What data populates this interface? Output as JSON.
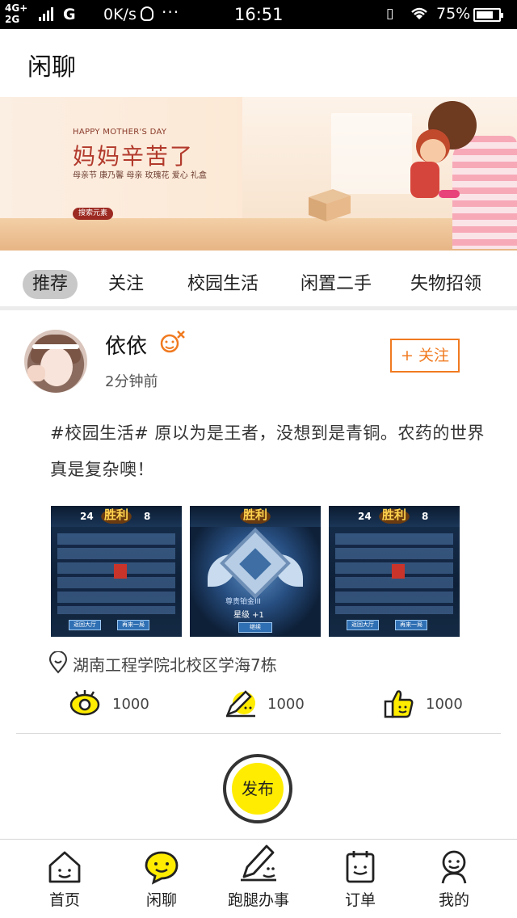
{
  "status_bar": {
    "network_top": "4G+",
    "network_bottom": "2G",
    "carrier": "G",
    "speed": "0K/s",
    "overflow": "···",
    "time": "16:51",
    "battery_percent": "75%",
    "battery_level": 0.75
  },
  "header": {
    "title": "闲聊"
  },
  "banner": {
    "subtitle_en": "HAPPY MOTHER'S DAY",
    "headline": "妈妈辛苦了",
    "tags": "母亲节 康乃馨 母亲 玫瑰花 爱心 礼盒",
    "button": "搜索元素"
  },
  "tabs": [
    {
      "label": "推荐",
      "active": true
    },
    {
      "label": "关注",
      "active": false
    },
    {
      "label": "校园生活",
      "active": false
    },
    {
      "label": "闲置二手",
      "active": false
    },
    {
      "label": "失物招领",
      "active": false
    }
  ],
  "post": {
    "username": "依依",
    "time_ago": "2分钟前",
    "follow_label": "+ 关注",
    "text": "#校园生活#  原以为是王者，没想到是青铜。农药的世界真是复杂噢！",
    "images": [
      {
        "type": "scoreboard",
        "title": "胜利",
        "left_score": "24",
        "right_score": "8",
        "btn1": "返回大厅",
        "btn2": "再来一局"
      },
      {
        "type": "rank",
        "title": "胜利",
        "rank_name": "尊贵铂金III",
        "star": "星级 +1",
        "btn": "继续"
      },
      {
        "type": "scoreboard",
        "title": "胜利",
        "left_score": "24",
        "right_score": "8",
        "btn1": "返回大厅",
        "btn2": "再来一局"
      }
    ],
    "location": "湖南工程学院北校区学海7栋",
    "stats": {
      "views": "1000",
      "comments": "1000",
      "likes": "1000"
    },
    "colors": {
      "accent": "#f07a20",
      "highlight": "#ffec00"
    }
  },
  "publish": {
    "label": "发布"
  },
  "bottom_nav": [
    {
      "label": "首页",
      "icon": "home-icon"
    },
    {
      "label": "闲聊",
      "icon": "chat-icon"
    },
    {
      "label": "跑腿办事",
      "icon": "errand-icon"
    },
    {
      "label": "订单",
      "icon": "order-icon"
    },
    {
      "label": "我的",
      "icon": "profile-icon"
    }
  ]
}
